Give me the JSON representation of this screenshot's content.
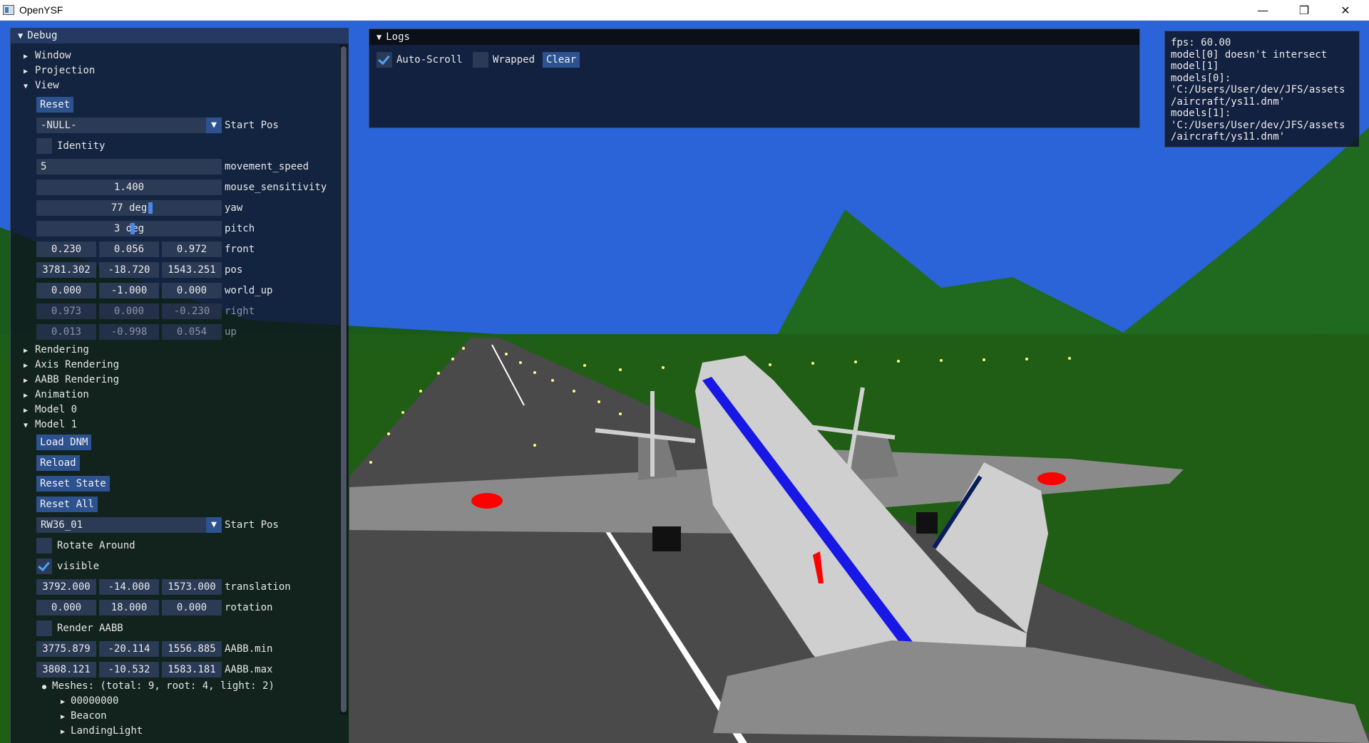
{
  "window": {
    "title": "OpenYSF",
    "minimize": "—",
    "maximize": "❐",
    "close": "✕"
  },
  "debug": {
    "title": "Debug",
    "tree_top": [
      "Window",
      "Projection",
      "View"
    ],
    "view": {
      "reset": "Reset",
      "start_combo": "-NULL-",
      "start_label": "Start Pos",
      "identity": "Identity",
      "movement_value": "5",
      "movement_label": "movement_speed",
      "mouse_value": "1.400",
      "mouse_label": "mouse_sensitivity",
      "yaw_value": "77 deg",
      "yaw_label": "yaw",
      "yaw_level": 0.62,
      "pitch_value": "3 deg",
      "pitch_label": "pitch",
      "pitch_level": 0.52,
      "vectors": [
        {
          "label": "front",
          "values": [
            "0.230",
            "0.056",
            "0.972"
          ],
          "disabled": false
        },
        {
          "label": "pos",
          "values": [
            "3781.302",
            "-18.720",
            "1543.251"
          ],
          "disabled": false
        },
        {
          "label": "world_up",
          "values": [
            "0.000",
            "-1.000",
            "0.000"
          ],
          "disabled": false
        },
        {
          "label": "right",
          "values": [
            "0.973",
            "0.000",
            "-0.230"
          ],
          "disabled": true
        },
        {
          "label": "up",
          "values": [
            "0.013",
            "-0.998",
            "0.054"
          ],
          "disabled": true
        }
      ]
    },
    "tree_mid": [
      "Rendering",
      "Axis Rendering",
      "AABB Rendering",
      "Animation",
      "Model 0",
      "Model 1"
    ],
    "model1": {
      "load": "Load DNM",
      "reload": "Reload",
      "reset_state": "Reset State",
      "reset_all": "Reset All",
      "start_combo": "RW36_01",
      "start_label": "Start Pos",
      "rotate_around": "Rotate Around",
      "visible": "visible",
      "translation": [
        "3792.000",
        "-14.000",
        "1573.000"
      ],
      "translation_label": "translation",
      "rotation": [
        "0.000",
        "18.000",
        "0.000"
      ],
      "rotation_label": "rotation",
      "render_aabb": "Render AABB",
      "aabb_min": [
        "3775.879",
        "-20.114",
        "1556.885"
      ],
      "aabb_min_label": "AABB.min",
      "aabb_max": [
        "3808.121",
        "-10.532",
        "1583.181"
      ],
      "aabb_max_label": "AABB.max",
      "meshes": "Meshes: (total: 9, root: 4, light: 2)",
      "mesh_items": [
        "00000000",
        "Beacon",
        "LandingLight"
      ]
    }
  },
  "logs": {
    "title": "Logs",
    "autoscroll": "Auto-Scroll",
    "wrapped": "Wrapped",
    "clear": "Clear"
  },
  "overlay": {
    "text": "fps: 60.00\nmodel[0] doesn't intersect\nmodel[1]\nmodels[0]:\n'C:/Users/User/dev/JFS/assets\n/aircraft/ys11.dnm'\nmodels[1]:\n'C:/Users/User/dev/JFS/assets\n/aircraft/ys11.dnm'"
  },
  "colors": {
    "sky": "#2a64d8",
    "ground": "#1f5e14",
    "runway": "#4a4a4a",
    "stripe": "#1717e6",
    "panel_bg": "#0f161e",
    "accent": "#2d5290"
  }
}
